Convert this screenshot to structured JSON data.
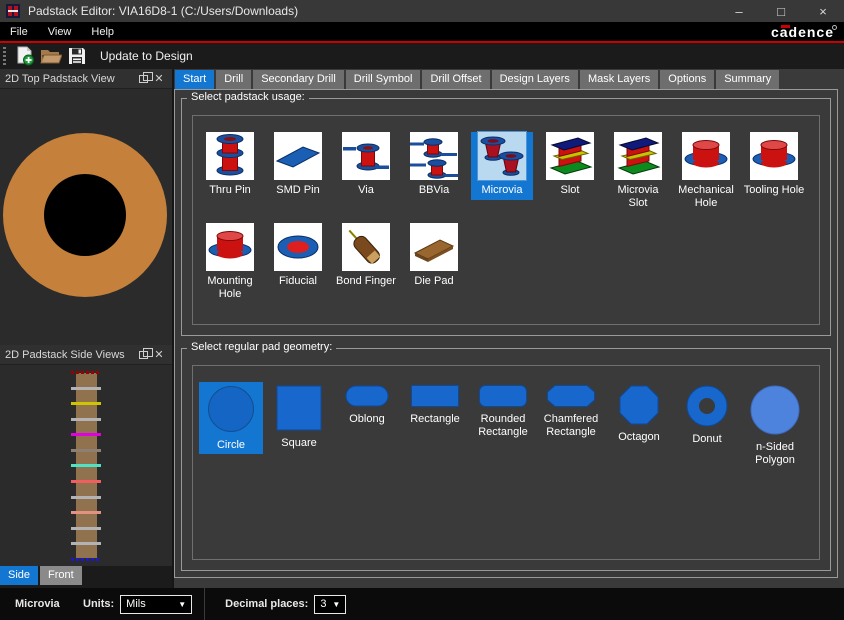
{
  "window": {
    "title": "Padstack Editor: VIA16D8-1 (C:/Users/Downloads)",
    "controls": {
      "minimize": "–",
      "maximize": "□",
      "close": "×"
    }
  },
  "menu": {
    "items": [
      {
        "label": "File"
      },
      {
        "label": "View"
      },
      {
        "label": "Help"
      }
    ],
    "brand": "cadence"
  },
  "toolbar": {
    "icons": [
      "new-padstack-icon",
      "open-icon",
      "save-icon"
    ],
    "update_label": "Update to Design"
  },
  "left": {
    "top_view": {
      "title": "2D Top Padstack View"
    },
    "side_view": {
      "title": "2D Padstack Side Views",
      "tabs": [
        {
          "label": "Side",
          "selected": true
        },
        {
          "label": "Front",
          "selected": false
        }
      ],
      "layers": [
        {
          "color": "#990000",
          "dotted": true
        },
        {
          "color": "#b3b3b3"
        },
        {
          "color": "#cfc400"
        },
        {
          "color": "#b3b3b3"
        },
        {
          "color": "#e000e0"
        },
        {
          "color": "#8f7f72"
        },
        {
          "color": "#4fe3c4"
        },
        {
          "color": "#f25d5d"
        },
        {
          "color": "#b3b3b3"
        },
        {
          "color": "#e39180"
        },
        {
          "color": "#b3b3b3"
        },
        {
          "color": "#b3b3b3"
        },
        {
          "color": "#1a1acc",
          "dotted": true
        }
      ]
    }
  },
  "tabs": {
    "items": [
      {
        "label": "Start",
        "selected": true
      },
      {
        "label": "Drill",
        "selected": false
      },
      {
        "label": "Secondary Drill",
        "selected": false
      },
      {
        "label": "Drill Symbol",
        "selected": false
      },
      {
        "label": "Drill Offset",
        "selected": false
      },
      {
        "label": "Design Layers",
        "selected": false
      },
      {
        "label": "Mask Layers",
        "selected": false
      },
      {
        "label": "Options",
        "selected": false
      },
      {
        "label": "Summary",
        "selected": false
      }
    ]
  },
  "usage": {
    "label": "Select padstack usage:",
    "items": [
      {
        "label": "Thru Pin",
        "selected": false
      },
      {
        "label": "SMD Pin",
        "selected": false
      },
      {
        "label": "Via",
        "selected": false
      },
      {
        "label": "BBVia",
        "selected": false
      },
      {
        "label": "Microvia",
        "selected": true
      },
      {
        "label": "Slot",
        "selected": false
      },
      {
        "label": "Microvia Slot",
        "selected": false
      },
      {
        "label": "Mechanical Hole",
        "selected": false
      },
      {
        "label": "Tooling Hole",
        "selected": false
      },
      {
        "label": "Mounting Hole",
        "selected": false
      },
      {
        "label": "Fiducial",
        "selected": false
      },
      {
        "label": "Bond Finger",
        "selected": false
      },
      {
        "label": "Die Pad",
        "selected": false
      }
    ]
  },
  "geometry": {
    "label": "Select regular pad geometry:",
    "items": [
      {
        "label": "Circle",
        "selected": true
      },
      {
        "label": "Square",
        "selected": false
      },
      {
        "label": "Oblong",
        "selected": false
      },
      {
        "label": "Rectangle",
        "selected": false
      },
      {
        "label": "Rounded Rectangle",
        "selected": false
      },
      {
        "label": "Chamfered Rectangle",
        "selected": false
      },
      {
        "label": "Octagon",
        "selected": false
      },
      {
        "label": "Donut",
        "selected": false
      },
      {
        "label": "n-Sided Polygon",
        "selected": false
      }
    ]
  },
  "status": {
    "usage_value": "Microvia",
    "units_label": "Units:",
    "units_value": "Mils",
    "decimal_label": "Decimal places:",
    "decimal_value": "3"
  },
  "colors": {
    "accent_blue": "#1377d2",
    "cadence_red": "#cc0000",
    "pad_orange": "#c5803b",
    "pad_hole_black": "#000000"
  }
}
